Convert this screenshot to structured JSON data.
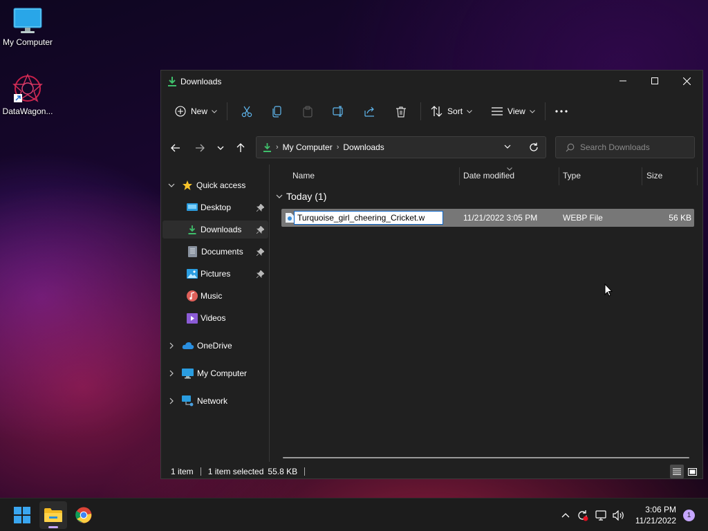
{
  "desktop": {
    "icons": [
      {
        "label": "My Computer",
        "icon": "monitor-icon"
      },
      {
        "label": "DataWagon...",
        "icon": "datawagon-app-icon"
      }
    ]
  },
  "window": {
    "title": "Downloads",
    "controls": {
      "minimize": "minimize-icon",
      "maximize": "maximize-icon",
      "close": "close-icon"
    }
  },
  "toolbar": {
    "new_label": "New",
    "sort_label": "Sort",
    "view_label": "View",
    "icons": [
      "plus-circle-icon",
      "cut-icon",
      "copy-icon",
      "paste-icon",
      "rename-icon",
      "share-icon",
      "delete-icon",
      "sort-icon",
      "view-icon",
      "more-icon"
    ]
  },
  "address": {
    "crumbs": [
      "My Computer",
      "Downloads"
    ]
  },
  "search": {
    "placeholder": "Search Downloads"
  },
  "nav": {
    "quick_access": "Quick access",
    "items": [
      {
        "label": "Desktop",
        "pinned": true
      },
      {
        "label": "Downloads",
        "pinned": true,
        "selected": true
      },
      {
        "label": "Documents",
        "pinned": true
      },
      {
        "label": "Pictures",
        "pinned": true
      },
      {
        "label": "Music",
        "pinned": false
      },
      {
        "label": "Videos",
        "pinned": false
      }
    ],
    "onedrive": "OneDrive",
    "my_computer": "My Computer",
    "network": "Network"
  },
  "columns": {
    "name": "Name",
    "date": "Date modified",
    "type": "Type",
    "size": "Size"
  },
  "groups": [
    {
      "title": "Today (1)",
      "files": [
        {
          "name": "Turquoise_girl_cheering_Cricket.w",
          "date": "11/21/2022 3:05 PM",
          "type": "WEBP File",
          "size": "56 KB"
        }
      ]
    }
  ],
  "status": {
    "count": "1 item",
    "selected": "1 item selected",
    "size": "55.8 KB"
  },
  "taskbar": {
    "time": "3:06 PM",
    "date": "11/21/2022",
    "notifications": "1",
    "apps": [
      "windows-start-icon",
      "file-explorer-icon",
      "chrome-icon"
    ],
    "tray_icons": [
      "chevron-up-icon",
      "update-icon",
      "network-icon",
      "volume-icon"
    ]
  },
  "colors": {
    "accent": "#4cc2ff",
    "download_green": "#3fbf6b",
    "selection": "#777777"
  }
}
